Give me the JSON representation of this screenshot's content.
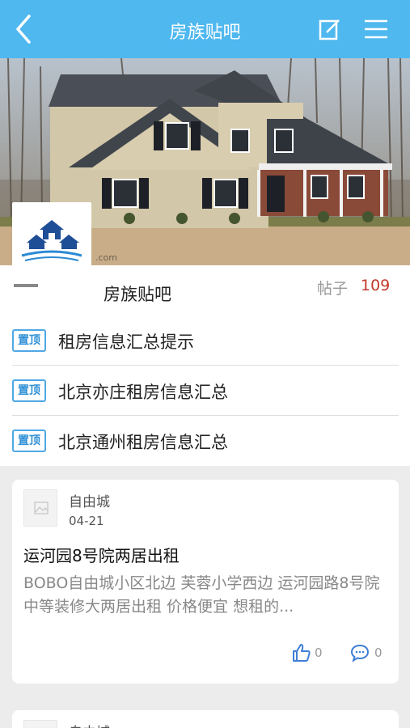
{
  "header": {
    "title": "房族贴吧",
    "back_icon": "chevron-left-icon",
    "edit_icon": "edit-icon",
    "menu_icon": "menu-icon"
  },
  "banner": {
    "watermark": ".com"
  },
  "forum": {
    "name": "房族贴吧",
    "posts_label": "帖子",
    "posts_count": "109"
  },
  "pinned": [
    {
      "badge": "置顶",
      "title": "租房信息汇总提示"
    },
    {
      "badge": "置顶",
      "title": "北京亦庄租房信息汇总"
    },
    {
      "badge": "置顶",
      "title": "北京通州租房信息汇总"
    }
  ],
  "posts": [
    {
      "author": "自由城",
      "date": "04-21",
      "title": "运河园8号院两居出租",
      "body": "BOBO自由城小区北边 芙蓉小学西边 运河园路8号院中等装修大两居出租 价格便宜 想租的...",
      "likes": "0",
      "comments": "0"
    },
    {
      "author": "自由城"
    }
  ],
  "colors": {
    "header_bg": "#4fb8ef",
    "badge": "#2d8fd6",
    "count": "#c0392b"
  }
}
